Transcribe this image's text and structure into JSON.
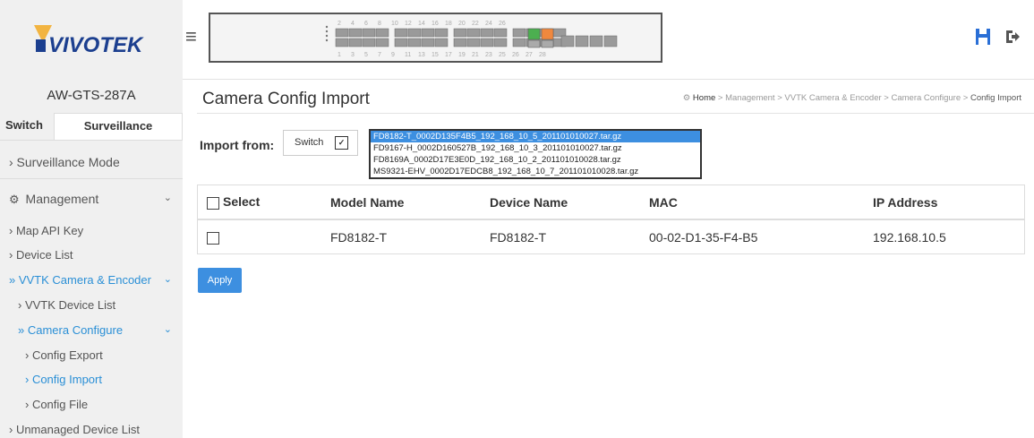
{
  "header": {
    "logo_text": "VIVOTEK",
    "save_icon": "save-icon",
    "logout_icon": "logout-icon",
    "port_numbers_top": [
      "2",
      "4",
      "6",
      "8",
      "10",
      "12",
      "14",
      "16",
      "18",
      "20",
      "22",
      "24",
      "26"
    ],
    "port_numbers_bottom": [
      "1",
      "3",
      "5",
      "7",
      "9",
      "11",
      "13",
      "15",
      "17",
      "19",
      "21",
      "23",
      "25",
      "26",
      "27",
      "28"
    ]
  },
  "sidebar": {
    "device_name": "AW-GTS-287A",
    "tab_switch": "Switch",
    "tab_surveillance": "Surveillance",
    "items": [
      {
        "label": "›  Surveillance Mode"
      },
      {
        "label": "Management"
      },
      {
        "label": "›  Map API Key"
      },
      {
        "label": "›  Device List"
      },
      {
        "label": "»  VVTK Camera & Encoder"
      },
      {
        "label": "›  VVTK Device List"
      },
      {
        "label": "»  Camera Configure"
      },
      {
        "label": "›  Config Export"
      },
      {
        "label": "›  Config Import"
      },
      {
        "label": "›  Config File"
      },
      {
        "label": "›  Unmanaged Device List"
      }
    ]
  },
  "main": {
    "title": "Camera Config Import",
    "breadcrumb": {
      "home": "Home",
      "sep": ">",
      "path": [
        "Management",
        "VVTK Camera & Encoder",
        "Camera Configure"
      ],
      "current": "Config Import"
    },
    "import_label": "Import from:",
    "import_value": "Switch",
    "dropdown_options": [
      "FD8182-T_0002D135F4B5_192_168_10_5_201101010027.tar.gz",
      "FD9167-H_0002D160527B_192_168_10_3_201101010027.tar.gz",
      "FD8169A_0002D17E3E0D_192_168_10_2_201101010028.tar.gz",
      "MS9321-EHV_0002D17EDCB8_192_168_10_7_201101010028.tar.gz"
    ],
    "table": {
      "headers": [
        "Select",
        "Model Name",
        "Device Name",
        "MAC",
        "IP Address"
      ],
      "rows": [
        {
          "model": "FD8182-T",
          "device": "FD8182-T",
          "mac": "00-02-D1-35-F4-B5",
          "ip": "192.168.10.5"
        }
      ]
    },
    "apply_label": "Apply"
  },
  "colors": {
    "accent": "#3d8fe0",
    "active_link": "#2a8fd6",
    "logo_blue": "#1c3f8f",
    "port_green": "#4caf50",
    "port_orange": "#f0883e"
  }
}
